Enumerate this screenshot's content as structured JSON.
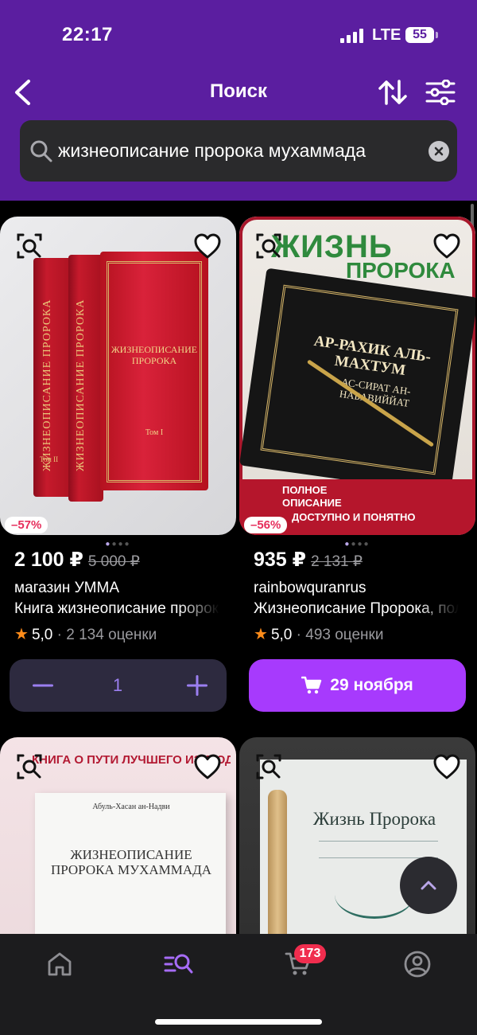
{
  "status_bar": {
    "time": "22:17",
    "network": "LTE",
    "battery": "55"
  },
  "header": {
    "title": "Поиск"
  },
  "search": {
    "value": "жизнеописание пророка мухаммада"
  },
  "products": [
    {
      "discount": "–57%",
      "price": "2 100 ₽",
      "old_price": "5 000 ₽",
      "seller": "магазин УММА",
      "title": "Книга жизнеописание пророка",
      "rating": "5,0",
      "reviews": "· 2 134 оценки",
      "quantity": "1",
      "cover_title": "ЖИЗНЕОПИСАНИЕ ПРОРОКА",
      "spine_text": "ЖИЗНЕОПИСАНИЕ ПРОРОКА",
      "vol1": "Том I",
      "vol2": "Том II"
    },
    {
      "discount": "–56%",
      "price": "935 ₽",
      "old_price": "2 131 ₽",
      "seller": "rainbowquranrus",
      "title": "Жизнеописание Пророка, полное",
      "rating": "5,0",
      "reviews": "· 493 оценки",
      "delivery": "29 ноября",
      "banner_1": "ЖИЗНЬ",
      "banner_2": "ПРОРОКА",
      "cover_title": "АР-РАХИК АЛЬ-МАХТУМ",
      "cover_sub": "АС-СИРАТ АН-НАБАВИЙЙАТ",
      "caption_1": "ПОЛНОЕ",
      "caption_2": "ОПИСАНИЕ",
      "caption_3": "ДОСТУПНО И ПОНЯТНО"
    },
    {
      "banner": "КНИГА О ПУТИ ЛУЧШЕГО ИЗ ЛЮДЕЙ",
      "author": "Абуль-Хасан ан-Надви",
      "cover_title": "ЖИЗНЕОПИСАНИЕ ПРОРОКА МУХАММАДА"
    },
    {
      "cover_title": "Жизнь Пророка"
    }
  ],
  "tabbar": {
    "cart_count": "173"
  },
  "colors": {
    "header": "#5b1ea0",
    "accent": "#a73afd",
    "discount": "#e62e5c"
  }
}
